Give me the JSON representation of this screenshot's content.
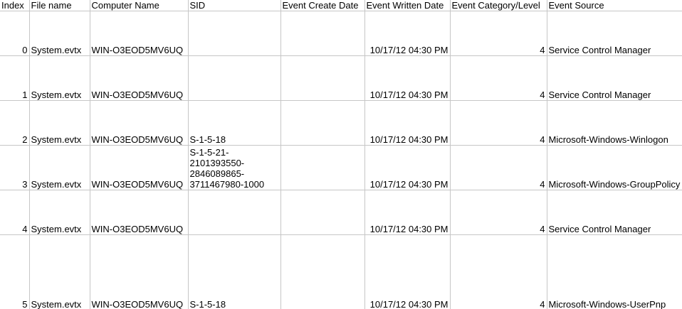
{
  "columns": [
    "Index",
    "File name",
    "Computer Name",
    "SID",
    "Event Create Date",
    "Event Written Date",
    "Event Category/Level",
    "Event Source"
  ],
  "rows": [
    {
      "index": "0",
      "file_name": "System.evtx",
      "computer_name": "WIN-O3EOD5MV6UQ",
      "sid": "",
      "event_create_date": "",
      "event_written_date": "10/17/12 04:30 PM",
      "event_category_level": "4",
      "event_source": "Service Control Manager"
    },
    {
      "index": "1",
      "file_name": "System.evtx",
      "computer_name": "WIN-O3EOD5MV6UQ",
      "sid": "",
      "event_create_date": "",
      "event_written_date": "10/17/12 04:30 PM",
      "event_category_level": "4",
      "event_source": "Service Control Manager"
    },
    {
      "index": "2",
      "file_name": "System.evtx",
      "computer_name": "WIN-O3EOD5MV6UQ",
      "sid": "S-1-5-18",
      "event_create_date": "",
      "event_written_date": "10/17/12 04:30 PM",
      "event_category_level": "4",
      "event_source": "Microsoft-Windows-Winlogon"
    },
    {
      "index": "3",
      "file_name": "System.evtx",
      "computer_name": "WIN-O3EOD5MV6UQ",
      "sid": "S-1-5-21-\n2101393550-\n2846089865-\n3711467980-1000",
      "event_create_date": "",
      "event_written_date": "10/17/12 04:30 PM",
      "event_category_level": "4",
      "event_source": "Microsoft-Windows-GroupPolicy"
    },
    {
      "index": "4",
      "file_name": "System.evtx",
      "computer_name": "WIN-O3EOD5MV6UQ",
      "sid": "",
      "event_create_date": "",
      "event_written_date": "10/17/12 04:30 PM",
      "event_category_level": "4",
      "event_source": "Service Control Manager"
    },
    {
      "index": "5",
      "file_name": "System.evtx",
      "computer_name": "WIN-O3EOD5MV6UQ",
      "sid": "S-1-5-18",
      "event_create_date": "",
      "event_written_date": "10/17/12 04:30 PM",
      "event_category_level": "4",
      "event_source": "Microsoft-Windows-UserPnp"
    }
  ]
}
